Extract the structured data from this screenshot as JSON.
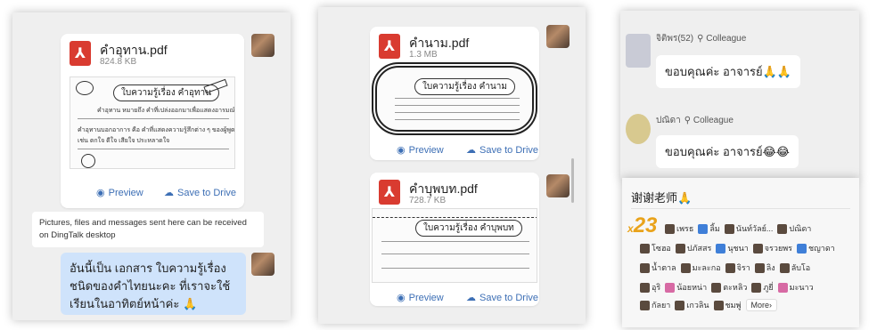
{
  "panel1": {
    "file": {
      "name": "คำอุทาน.pdf",
      "size": "824.8 KB",
      "preview_title": "ใบความรู้เรื่อง คำอุทาน",
      "sheet_lines": [
        "คำอุทาน หมายถึง คำที่เปล่งออกมาเพื่อแสดงอารมณ์หรือความรู้สึก",
        "คำอุทานบอกอาการ คือ คำที่แสดงความรู้สึกต่าง ๆ ของผู้พูด",
        "เช่น ตกใจ ดีใจ เสียใจ ประหลาดใจ"
      ]
    },
    "preview_label": "Preview",
    "save_label": "Save to Drive",
    "system_message": "Pictures, files and messages sent here can be received on DingTalk desktop",
    "bubble_text": "อันนี้เป็น เอกสาร ใบความรู้เรื่อง ชนิดของคำไทยนะคะ ที่เราจะใช้เรียนในอาทิตย์หน้าค่ะ 🙏"
  },
  "panel2": {
    "file1": {
      "name": "คำนาม.pdf",
      "size": "1.3 MB",
      "preview_title": "ใบความรู้เรื่อง คำนาม"
    },
    "file2": {
      "name": "คำบุพบท.pdf",
      "size": "728.7 KB",
      "preview_title": "ใบความรู้เรื่อง คำบุพบท"
    },
    "preview_label": "Preview",
    "save_label": "Save to Drive"
  },
  "panel3": {
    "msg1": {
      "sender": "จิติพร(52)",
      "tag": "Colleague",
      "text": "ขอบคุณค่ะ อาจารย์🙏🙏"
    },
    "msg2": {
      "sender": "ปณิดา",
      "tag": "Colleague",
      "text": "ขอบคุณค่ะ อาจารย์😂😂"
    }
  },
  "panel4": {
    "title": "谢谢老师🙏",
    "multiplier_prefix": "x",
    "multiplier_value": "23",
    "rows": [
      [
        "เพรธ",
        "ลิ้ม",
        "นันท์วัลย์...",
        "ปณิดา"
      ],
      [
        "โซฮอ",
        "ปภัสสร",
        "นุชนา",
        "จรวยพร",
        "ชญาดา"
      ],
      [
        "น้ำตาล",
        "มะละกอ",
        "จิรา",
        "ลิง",
        "ลับโอ"
      ],
      [
        "อุริ",
        "น้อยหน่า",
        "ตะหลิว",
        "ภูยี่",
        "มะนาว"
      ],
      [
        "กัลยา",
        "เกวลิน",
        "ชมพู่"
      ]
    ],
    "more_label": "More›"
  }
}
